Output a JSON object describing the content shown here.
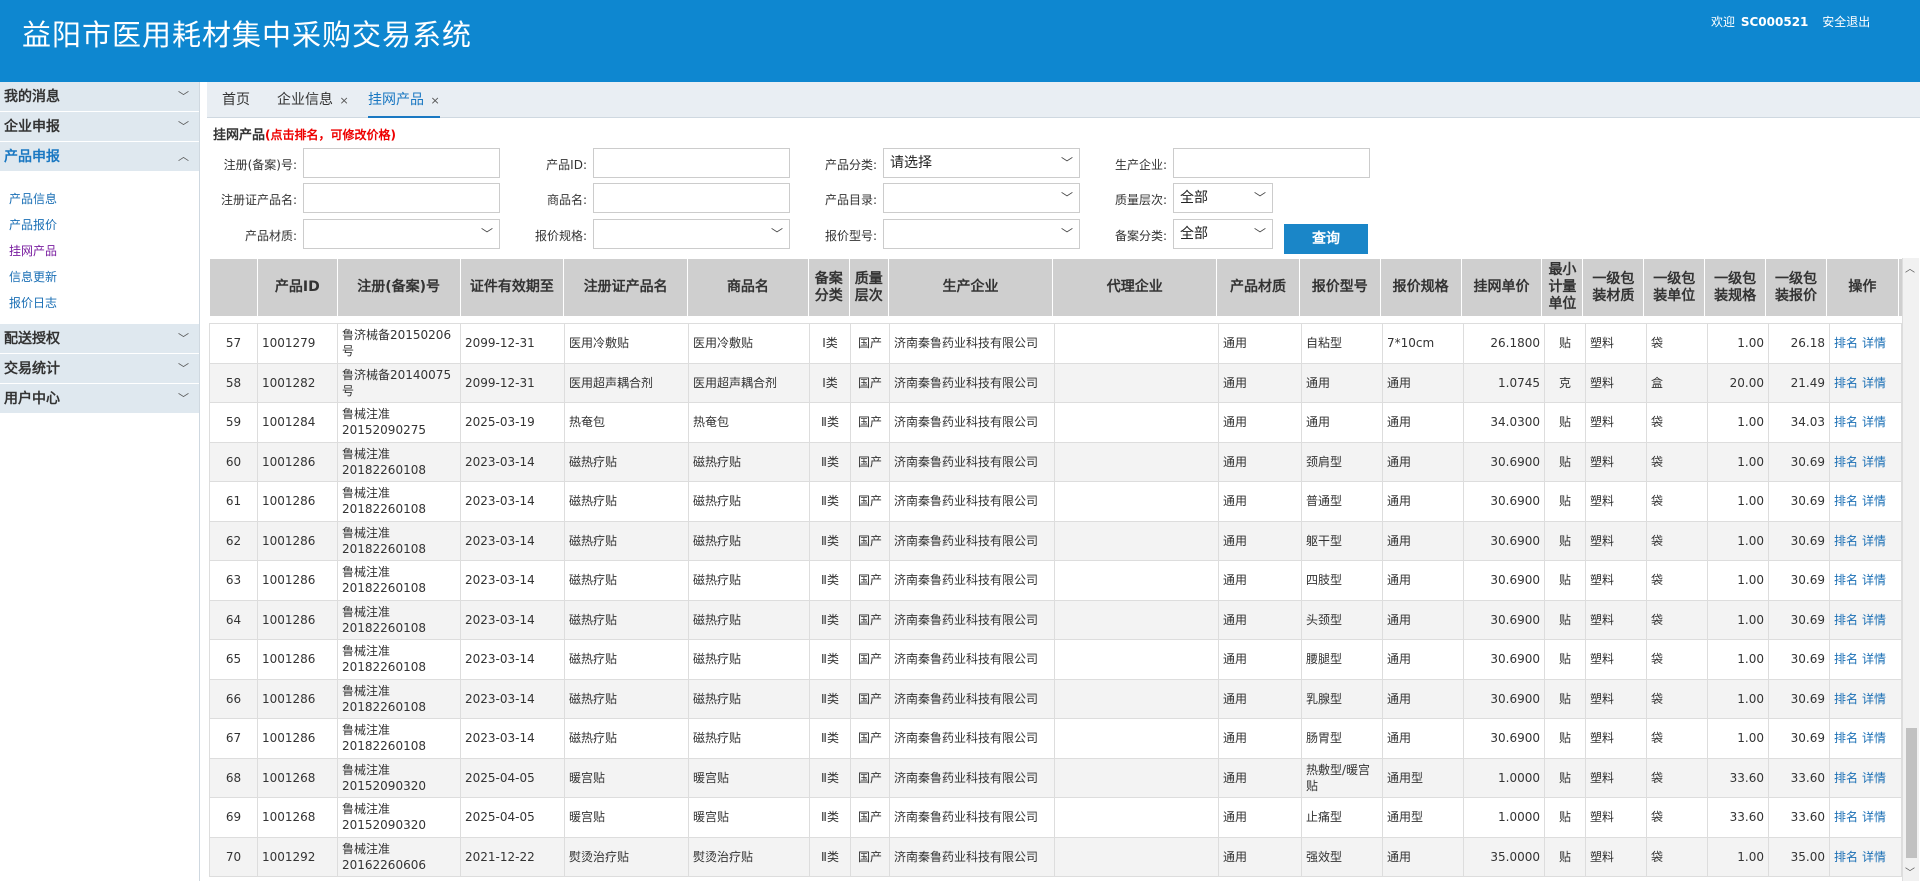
{
  "header": {
    "title": "益阳市医用耗材集中采购交易系统",
    "welcome": "欢迎",
    "user_id": "SC000521",
    "logout": "安全退出"
  },
  "sidebar": {
    "groups": [
      {
        "label": "我的消息",
        "chevron": "chevron-down-icon"
      },
      {
        "label": "企业申报",
        "chevron": "chevron-down-icon"
      },
      {
        "label": "产品申报",
        "chevron": "chevron-up-icon"
      }
    ],
    "sub_items": [
      {
        "label": "产品信息"
      },
      {
        "label": "产品报价"
      },
      {
        "label": "挂网产品"
      },
      {
        "label": "信息更新"
      },
      {
        "label": "报价日志"
      }
    ],
    "groups_after": [
      {
        "label": "配送授权"
      },
      {
        "label": "交易统计"
      },
      {
        "label": "用户中心"
      }
    ]
  },
  "tabs": [
    {
      "label": "首页"
    },
    {
      "label": "企业信息"
    },
    {
      "label": "挂网产品"
    }
  ],
  "tab_close_glyph": "×",
  "section": {
    "title": "挂网产品",
    "hint": "(点击排名，可修改价格)"
  },
  "filters": {
    "reg_no_label": "注册(备案)号:",
    "product_id_label": "产品ID:",
    "category_label": "产品分类:",
    "category_value": "请选择",
    "manufacturer_label": "生产企业:",
    "reg_name_label": "注册证产品名:",
    "trade_name_label": "商品名:",
    "catalog_label": "产品目录:",
    "quality_label": "质量层次:",
    "quality_value": "全部",
    "material_label": "产品材质:",
    "spec_label": "报价规格:",
    "model_label": "报价型号:",
    "filing_label": "备案分类:",
    "filing_value": "全部",
    "search_button": "查询"
  },
  "table": {
    "headers": [
      "",
      "产品ID",
      "注册(备案)号",
      "证件有效期至",
      "注册证产品名",
      "商品名",
      "备案分类",
      "质量层次",
      "生产企业",
      "代理企业",
      "产品材质",
      "报价型号",
      "报价规格",
      "挂网单价",
      "最小计量单位",
      "一级包装材质",
      "一级包装单位",
      "一级包装规格",
      "一级包装报价",
      "操作"
    ],
    "rows": [
      [
        "57",
        "1001279",
        "鲁济械备20150206号",
        "2099-12-31",
        "医用冷敷贴",
        "医用冷敷贴",
        "Ⅰ类",
        "国产",
        "济南秦鲁药业科技有限公司",
        "",
        "通用",
        "自粘型",
        "7*10cm",
        "26.1800",
        "贴",
        "塑料",
        "袋",
        "1.00",
        "26.18"
      ],
      [
        "58",
        "1001282",
        "鲁济械备20140075号",
        "2099-12-31",
        "医用超声耦合剂",
        "医用超声耦合剂",
        "Ⅰ类",
        "国产",
        "济南秦鲁药业科技有限公司",
        "",
        "通用",
        "通用",
        "通用",
        "1.0745",
        "克",
        "塑料",
        "盒",
        "20.00",
        "21.49"
      ],
      [
        "59",
        "1001284",
        "鲁械注准20152090275",
        "2025-03-19",
        "热奄包",
        "热奄包",
        "Ⅱ类",
        "国产",
        "济南秦鲁药业科技有限公司",
        "",
        "通用",
        "通用",
        "通用",
        "34.0300",
        "贴",
        "塑料",
        "袋",
        "1.00",
        "34.03"
      ],
      [
        "60",
        "1001286",
        "鲁械注准20182260108",
        "2023-03-14",
        "磁热疗贴",
        "磁热疗贴",
        "Ⅱ类",
        "国产",
        "济南秦鲁药业科技有限公司",
        "",
        "通用",
        "颈肩型",
        "通用",
        "30.6900",
        "贴",
        "塑料",
        "袋",
        "1.00",
        "30.69"
      ],
      [
        "61",
        "1001286",
        "鲁械注准20182260108",
        "2023-03-14",
        "磁热疗贴",
        "磁热疗贴",
        "Ⅱ类",
        "国产",
        "济南秦鲁药业科技有限公司",
        "",
        "通用",
        "普通型",
        "通用",
        "30.6900",
        "贴",
        "塑料",
        "袋",
        "1.00",
        "30.69"
      ],
      [
        "62",
        "1001286",
        "鲁械注准20182260108",
        "2023-03-14",
        "磁热疗贴",
        "磁热疗贴",
        "Ⅱ类",
        "国产",
        "济南秦鲁药业科技有限公司",
        "",
        "通用",
        "躯干型",
        "通用",
        "30.6900",
        "贴",
        "塑料",
        "袋",
        "1.00",
        "30.69"
      ],
      [
        "63",
        "1001286",
        "鲁械注准20182260108",
        "2023-03-14",
        "磁热疗贴",
        "磁热疗贴",
        "Ⅱ类",
        "国产",
        "济南秦鲁药业科技有限公司",
        "",
        "通用",
        "四肢型",
        "通用",
        "30.6900",
        "贴",
        "塑料",
        "袋",
        "1.00",
        "30.69"
      ],
      [
        "64",
        "1001286",
        "鲁械注准20182260108",
        "2023-03-14",
        "磁热疗贴",
        "磁热疗贴",
        "Ⅱ类",
        "国产",
        "济南秦鲁药业科技有限公司",
        "",
        "通用",
        "头颈型",
        "通用",
        "30.6900",
        "贴",
        "塑料",
        "袋",
        "1.00",
        "30.69"
      ],
      [
        "65",
        "1001286",
        "鲁械注准20182260108",
        "2023-03-14",
        "磁热疗贴",
        "磁热疗贴",
        "Ⅱ类",
        "国产",
        "济南秦鲁药业科技有限公司",
        "",
        "通用",
        "腰腿型",
        "通用",
        "30.6900",
        "贴",
        "塑料",
        "袋",
        "1.00",
        "30.69"
      ],
      [
        "66",
        "1001286",
        "鲁械注准20182260108",
        "2023-03-14",
        "磁热疗贴",
        "磁热疗贴",
        "Ⅱ类",
        "国产",
        "济南秦鲁药业科技有限公司",
        "",
        "通用",
        "乳腺型",
        "通用",
        "30.6900",
        "贴",
        "塑料",
        "袋",
        "1.00",
        "30.69"
      ],
      [
        "67",
        "1001286",
        "鲁械注准20182260108",
        "2023-03-14",
        "磁热疗贴",
        "磁热疗贴",
        "Ⅱ类",
        "国产",
        "济南秦鲁药业科技有限公司",
        "",
        "通用",
        "肠胃型",
        "通用",
        "30.6900",
        "贴",
        "塑料",
        "袋",
        "1.00",
        "30.69"
      ],
      [
        "68",
        "1001268",
        "鲁械注准20152090320",
        "2025-04-05",
        "暖宫贴",
        "暖宫贴",
        "Ⅱ类",
        "国产",
        "济南秦鲁药业科技有限公司",
        "",
        "通用",
        "热敷型/暖宫贴",
        "通用型",
        "1.0000",
        "贴",
        "塑料",
        "袋",
        "33.60",
        "33.60"
      ],
      [
        "69",
        "1001268",
        "鲁械注准20152090320",
        "2025-04-05",
        "暖宫贴",
        "暖宫贴",
        "Ⅱ类",
        "国产",
        "济南秦鲁药业科技有限公司",
        "",
        "通用",
        "止痛型",
        "通用型",
        "1.0000",
        "贴",
        "塑料",
        "袋",
        "33.60",
        "33.60"
      ],
      [
        "70",
        "1001292",
        "鲁械注准20162260606",
        "2021-12-22",
        "熨烫治疗贴",
        "熨烫治疗贴",
        "Ⅱ类",
        "国产",
        "济南秦鲁药业科技有限公司",
        "",
        "通用",
        "强效型",
        "通用",
        "35.0000",
        "贴",
        "塑料",
        "袋",
        "1.00",
        "35.00"
      ]
    ],
    "op_rank": "排名",
    "op_detail": "详情"
  }
}
